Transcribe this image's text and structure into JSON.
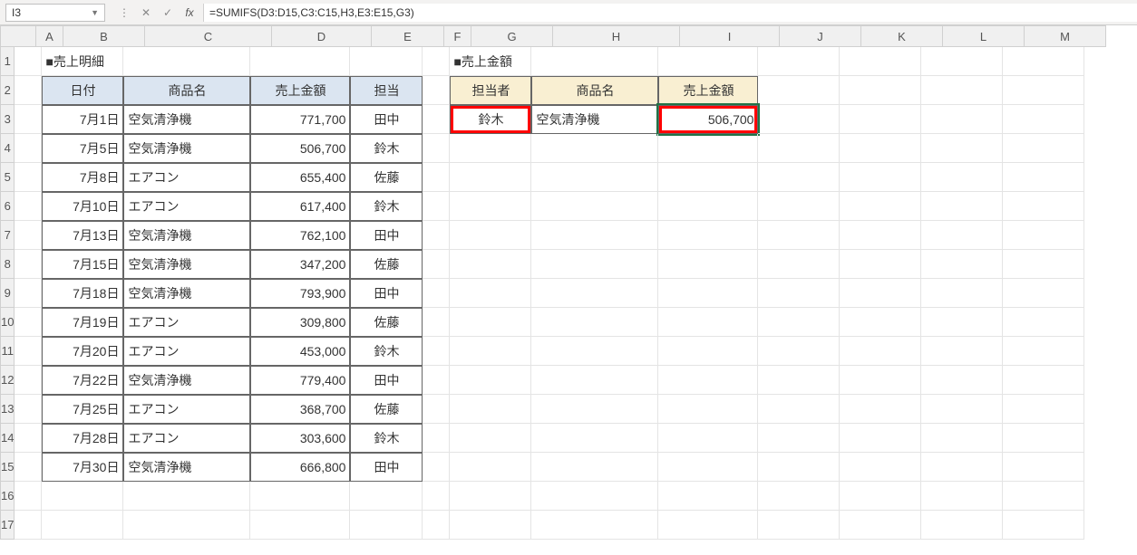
{
  "formula_bar": {
    "name_box": "I3",
    "formula": "=SUMIFS(D3:D15,C3:C15,H3,E3:E15,G3)"
  },
  "columns": [
    "A",
    "B",
    "C",
    "D",
    "E",
    "F",
    "G",
    "H",
    "I",
    "J",
    "K",
    "L",
    "M"
  ],
  "row_numbers": [
    "1",
    "2",
    "3",
    "4",
    "5",
    "6",
    "7",
    "8",
    "9",
    "10",
    "11",
    "12",
    "13",
    "14",
    "15",
    "16",
    "17"
  ],
  "left_title": "■売上明細",
  "left_headers": {
    "b": "日付",
    "c": "商品名",
    "d": "売上金額",
    "e": "担当"
  },
  "left_rows": [
    {
      "date": "7月1日",
      "product": "空気清浄機",
      "amount": "771,700",
      "rep": "田中"
    },
    {
      "date": "7月5日",
      "product": "空気清浄機",
      "amount": "506,700",
      "rep": "鈴木"
    },
    {
      "date": "7月8日",
      "product": "エアコン",
      "amount": "655,400",
      "rep": "佐藤"
    },
    {
      "date": "7月10日",
      "product": "エアコン",
      "amount": "617,400",
      "rep": "鈴木"
    },
    {
      "date": "7月13日",
      "product": "空気清浄機",
      "amount": "762,100",
      "rep": "田中"
    },
    {
      "date": "7月15日",
      "product": "空気清浄機",
      "amount": "347,200",
      "rep": "佐藤"
    },
    {
      "date": "7月18日",
      "product": "空気清浄機",
      "amount": "793,900",
      "rep": "田中"
    },
    {
      "date": "7月19日",
      "product": "エアコン",
      "amount": "309,800",
      "rep": "佐藤"
    },
    {
      "date": "7月20日",
      "product": "エアコン",
      "amount": "453,000",
      "rep": "鈴木"
    },
    {
      "date": "7月22日",
      "product": "空気清浄機",
      "amount": "779,400",
      "rep": "田中"
    },
    {
      "date": "7月25日",
      "product": "エアコン",
      "amount": "368,700",
      "rep": "佐藤"
    },
    {
      "date": "7月28日",
      "product": "エアコン",
      "amount": "303,600",
      "rep": "鈴木"
    },
    {
      "date": "7月30日",
      "product": "空気清浄機",
      "amount": "666,800",
      "rep": "田中"
    }
  ],
  "right_title": "■売上金額",
  "right_headers": {
    "g": "担当者",
    "h": "商品名",
    "i": "売上金額"
  },
  "right_row": {
    "rep": "鈴木",
    "product": "空気清浄機",
    "amount": "506,700"
  }
}
